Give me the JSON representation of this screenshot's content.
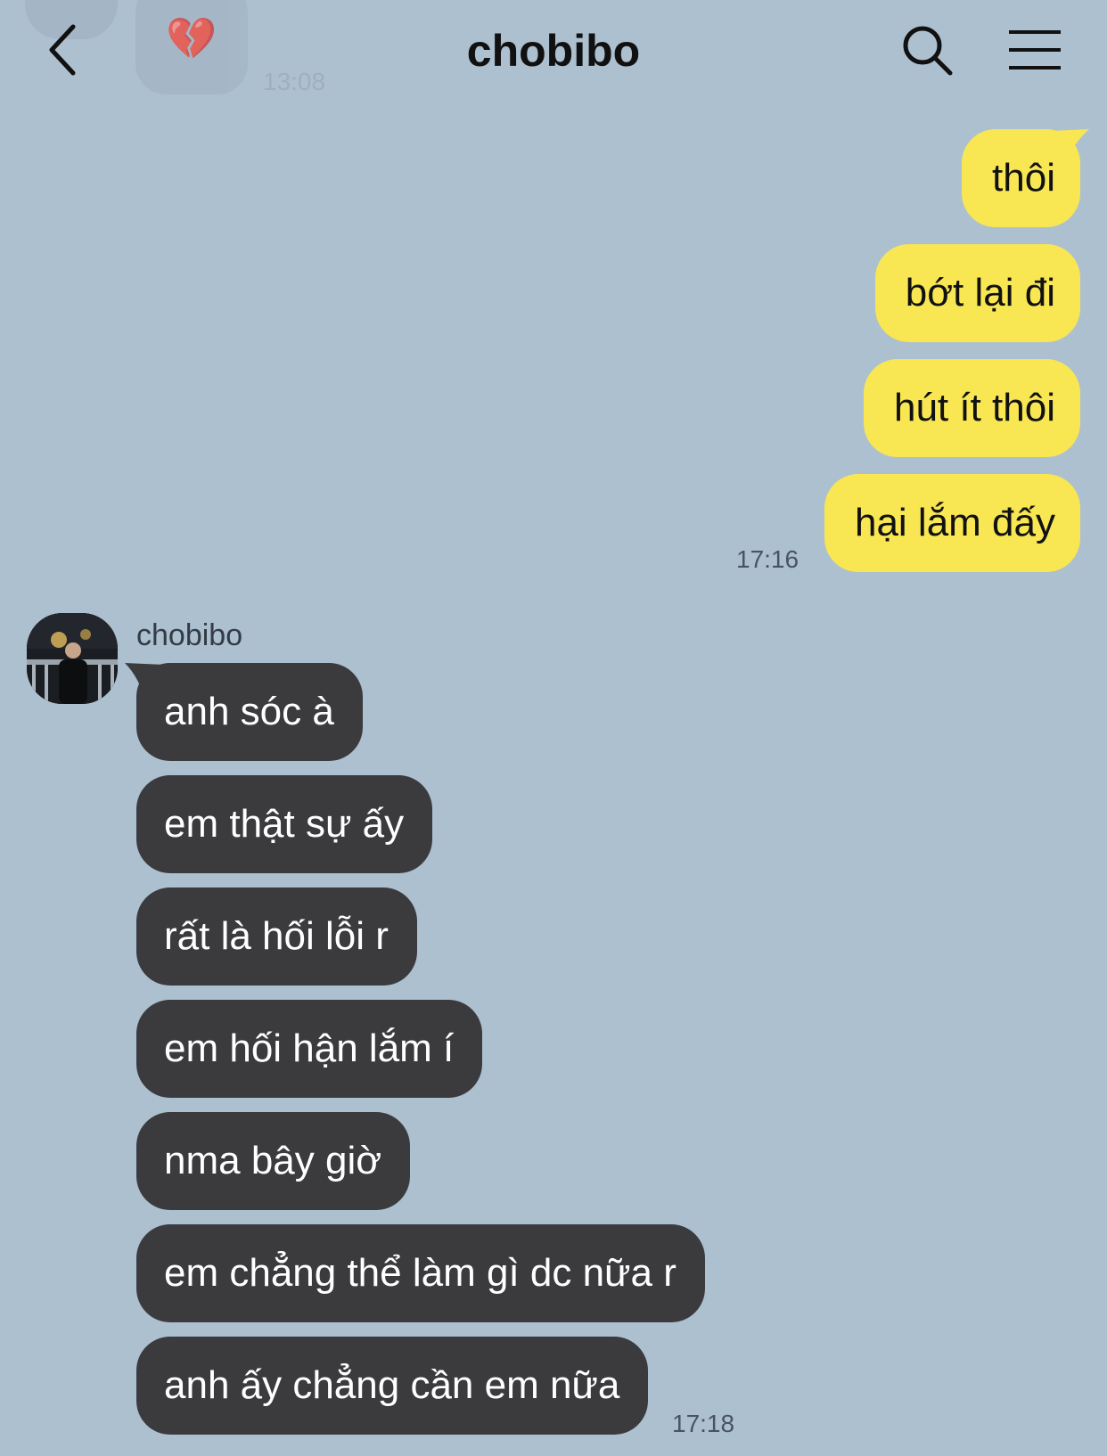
{
  "header": {
    "title": "chobibo",
    "back_icon": "chevron-left-icon",
    "search_icon": "search-icon",
    "menu_icon": "hamburger-menu-icon"
  },
  "previous_message": {
    "time": "13:08",
    "icon": "broken-heart-icon"
  },
  "outgoing_group": {
    "messages": [
      "thôi",
      "bớt lại đi",
      "hút ít thôi",
      "hại lắm đấy"
    ],
    "time": "17:16",
    "bubble_color": "#f8e652"
  },
  "incoming_group": {
    "sender": "chobibo",
    "messages": [
      "anh sóc à",
      "em thật sự ấy",
      "rất là hối lỗi r",
      "em hối hận lắm í",
      "nma bây giờ",
      "em chẳng thể làm gì dc nữa r",
      "anh ấy chẳng cần em nữa"
    ],
    "time": "17:18",
    "bubble_color": "#3b3b3e"
  },
  "colors": {
    "background": "#adc0d0"
  }
}
